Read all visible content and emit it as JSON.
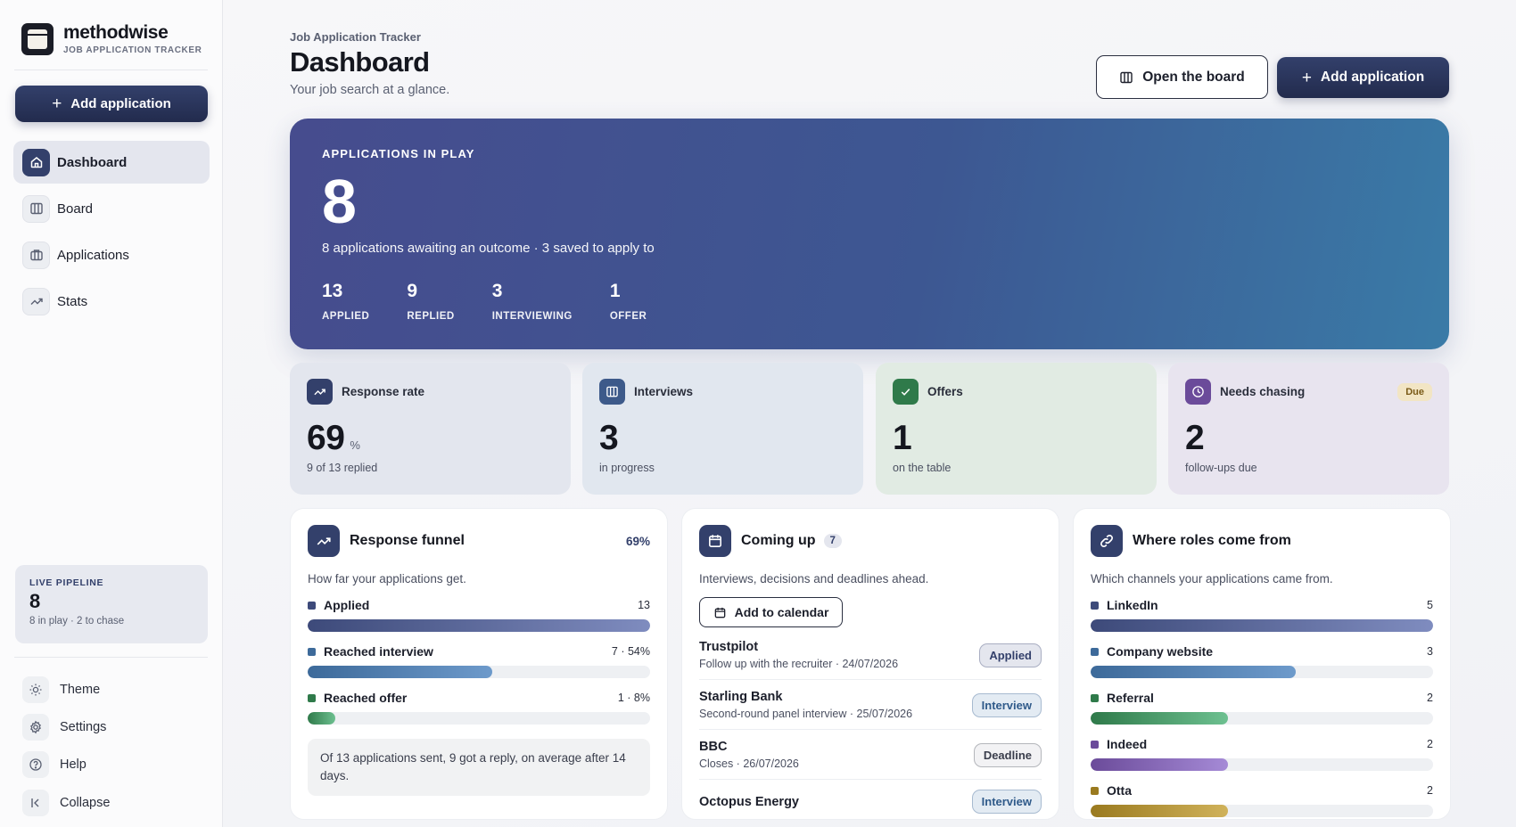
{
  "brand": {
    "name": "methodwise",
    "subtitle": "JOB APPLICATION TRACKER"
  },
  "sidebar": {
    "add_label": "Add application",
    "nav": [
      {
        "label": "Dashboard",
        "icon": "home-icon",
        "active": true
      },
      {
        "label": "Board",
        "icon": "columns-icon"
      },
      {
        "label": "Applications",
        "icon": "briefcase-icon"
      },
      {
        "label": "Stats",
        "icon": "trend-icon"
      }
    ],
    "pipeline": {
      "label": "LIVE PIPELINE",
      "value": "8",
      "sub": "8 in play · 2 to chase"
    },
    "utilities": [
      {
        "label": "Theme",
        "icon": "sun-icon"
      },
      {
        "label": "Settings",
        "icon": "gear-icon"
      },
      {
        "label": "Help",
        "icon": "help-icon"
      },
      {
        "label": "Collapse",
        "icon": "collapse-icon"
      }
    ]
  },
  "header": {
    "breadcrumb": "Job Application Tracker",
    "title": "Dashboard",
    "subtitle": "Your job search at a glance.",
    "open_board_label": "Open the board",
    "add_label": "Add application"
  },
  "hero": {
    "label": "APPLICATIONS IN PLAY",
    "value": "8",
    "sub": "8 applications awaiting an outcome · 3 saved to apply to",
    "stats": [
      {
        "value": "13",
        "label": "APPLIED"
      },
      {
        "value": "9",
        "label": "REPLIED"
      },
      {
        "value": "3",
        "label": "INTERVIEWING"
      },
      {
        "value": "1",
        "label": "OFFER"
      }
    ]
  },
  "kpis": [
    {
      "label": "Response rate",
      "value": "69",
      "unit": "%",
      "sub": "9 of 13 replied",
      "icon": "trend-icon",
      "bg": "#e3e6ee",
      "icon_bg": "#33406b"
    },
    {
      "label": "Interviews",
      "value": "3",
      "unit": "",
      "sub": "in progress",
      "icon": "columns-icon",
      "bg": "#e1e7ef",
      "icon_bg": "#3d5a8a"
    },
    {
      "label": "Offers",
      "value": "1",
      "unit": "",
      "sub": "on the table",
      "icon": "check-icon",
      "bg": "#e1ebe3",
      "icon_bg": "#2f7a4a"
    },
    {
      "label": "Needs chasing",
      "value": "2",
      "unit": "",
      "sub": "follow-ups due",
      "icon": "clock-icon",
      "bg": "#e8e4ef",
      "icon_bg": "#6b4b9a",
      "badge": "Due"
    }
  ],
  "funnel": {
    "title": "Response funnel",
    "pct": "69%",
    "desc": "How far your applications get.",
    "rows": [
      {
        "label": "Applied",
        "value": "13",
        "fraction": 1.0,
        "color": "#3d4a7a",
        "fill": "linear-gradient(90deg,#3d4a7a,#7f8cbf)"
      },
      {
        "label": "Reached interview",
        "value": "7 · 54%",
        "fraction": 0.54,
        "color": "#3d6a9a",
        "fill": "linear-gradient(90deg,#3d6a9a,#6d9acb)"
      },
      {
        "label": "Reached offer",
        "value": "1 · 8%",
        "fraction": 0.08,
        "color": "#2f7a4a",
        "fill": "linear-gradient(90deg,#2f7a4a,#6dc090)"
      }
    ],
    "note": "Of 13 applications sent, 9 got a reply, on average after 14 days."
  },
  "coming_up": {
    "title": "Coming up",
    "count": "7",
    "desc": "Interviews, decisions and deadlines ahead.",
    "calendar_label": "Add to calendar",
    "events": [
      {
        "title": "Trustpilot",
        "sub": "Follow up with the recruiter · 24/07/2026",
        "tag": "Applied",
        "tag_color": "#33406b",
        "tag_bg": "#e4e6ee"
      },
      {
        "title": "Starling Bank",
        "sub": "Second-round panel interview · 25/07/2026",
        "tag": "Interview",
        "tag_color": "#2f5a8a",
        "tag_bg": "#e3ebf3"
      },
      {
        "title": "BBC",
        "sub": "Closes · 26/07/2026",
        "tag": "Deadline",
        "tag_color": "#3a3e4c",
        "tag_bg": "#f2f2f4"
      },
      {
        "title": "Octopus Energy",
        "sub": "",
        "tag": "Interview",
        "tag_color": "#2f5a8a",
        "tag_bg": "#e3ebf3"
      }
    ]
  },
  "sources": {
    "title": "Where roles come from",
    "desc": "Which channels your applications came from.",
    "rows": [
      {
        "label": "LinkedIn",
        "value": "5",
        "fraction": 1.0,
        "color": "#3d4a7a",
        "fill": "linear-gradient(90deg,#3d4a7a,#7f8cbf)"
      },
      {
        "label": "Company website",
        "value": "3",
        "fraction": 0.6,
        "color": "#3d6a9a",
        "fill": "linear-gradient(90deg,#3d6a9a,#6d9acb)"
      },
      {
        "label": "Referral",
        "value": "2",
        "fraction": 0.4,
        "color": "#2f7a4a",
        "fill": "linear-gradient(90deg,#2f7a4a,#6dc090)"
      },
      {
        "label": "Indeed",
        "value": "2",
        "fraction": 0.4,
        "color": "#6b4b9a",
        "fill": "linear-gradient(90deg,#6b4b9a,#a58ad6)"
      },
      {
        "label": "Otta",
        "value": "2",
        "fraction": 0.4,
        "color": "#9a7a1f",
        "fill": "linear-gradient(90deg,#9a7a1f,#d0b25a)"
      }
    ]
  }
}
